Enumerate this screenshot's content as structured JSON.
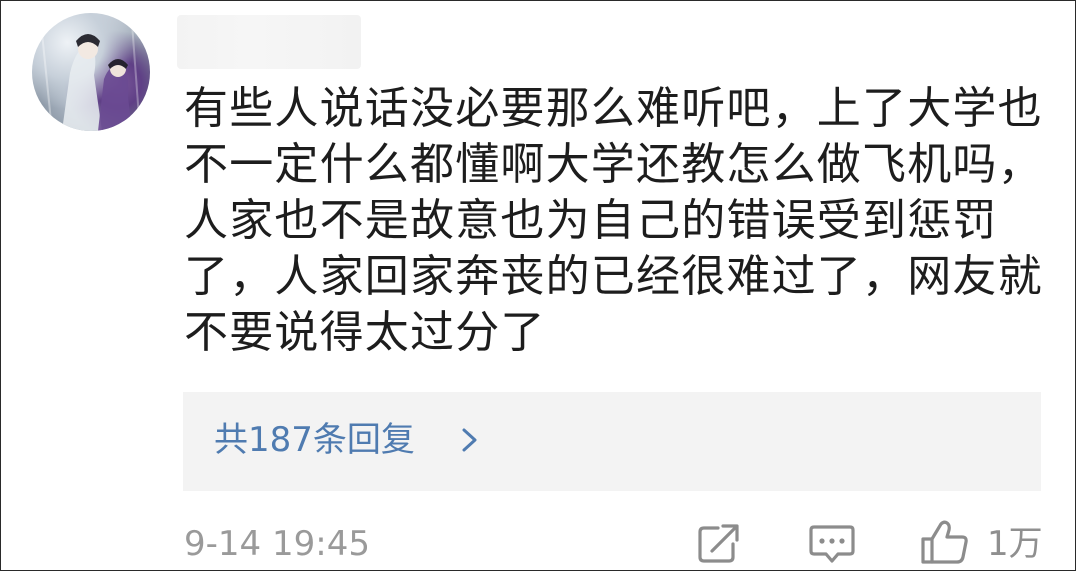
{
  "comment": {
    "username": "",
    "lines": [
      "有些人说话没必要那么难听吧，上了大学也",
      "不一定什么都懂啊大学还教怎么做飞机吗，",
      "人家也不是故意也为自己的错误受到惩罚",
      "了，人家回家奔丧的已经很难过了，网友就",
      "不要说得太过分了"
    ]
  },
  "replies": {
    "label": "共187条回复"
  },
  "footer": {
    "timestamp": "9-14 19:45",
    "like_count": "1万"
  },
  "icons": {
    "share": "share-icon",
    "reply": "comment-icon",
    "like": "thumbs-up-icon",
    "chevron": "chevron-right-icon"
  },
  "colors": {
    "reply_link": "#4f7bb0",
    "meta_text": "#9a9a9a",
    "reply_box_bg": "#f3f3f3"
  }
}
